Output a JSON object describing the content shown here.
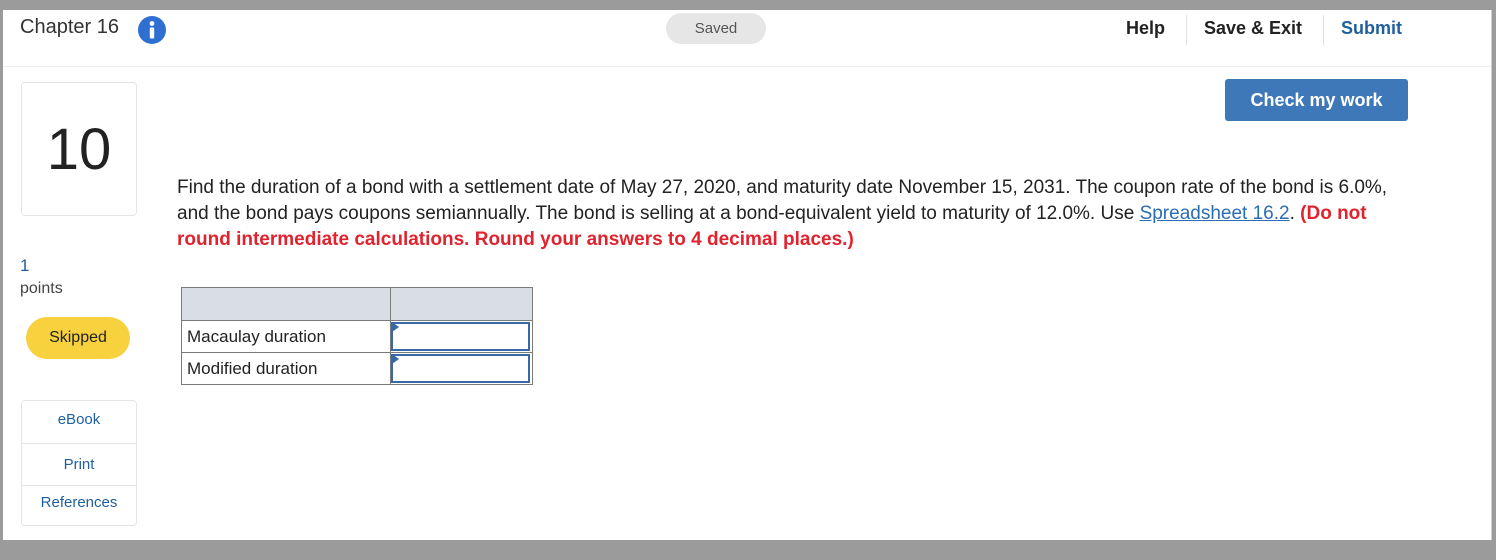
{
  "header": {
    "chapter_title": "Chapter 16",
    "saved_status": "Saved",
    "help_label": "Help",
    "save_exit_label": "Save & Exit",
    "submit_label": "Submit"
  },
  "actions": {
    "check_my_work_label": "Check my work"
  },
  "question": {
    "number": "10",
    "points_value": "1",
    "points_label": "points",
    "status_badge": "Skipped",
    "text_before_link": "Find the duration of a bond with a settlement date of May 27, 2020, and maturity date November 15, 2031. The coupon rate of the bond is 6.0%, and the bond pays coupons semiannually. The bond is selling at a bond-equivalent yield to maturity of 12.0%. Use ",
    "link_text": "Spreadsheet 16.2",
    "text_after_link": ". ",
    "instruction": "(Do not round intermediate calculations. Round your answers to 4 decimal places.)"
  },
  "resources": {
    "items": [
      "eBook",
      "Print",
      "References"
    ]
  },
  "answer_table": {
    "rows": [
      {
        "label": "Macaulay duration",
        "value": ""
      },
      {
        "label": "Modified duration",
        "value": ""
      }
    ]
  },
  "colors": {
    "accent": "#3f78b9",
    "link": "#2a6db5",
    "warning": "#e0232e",
    "skipped_badge": "#f7d23e"
  }
}
